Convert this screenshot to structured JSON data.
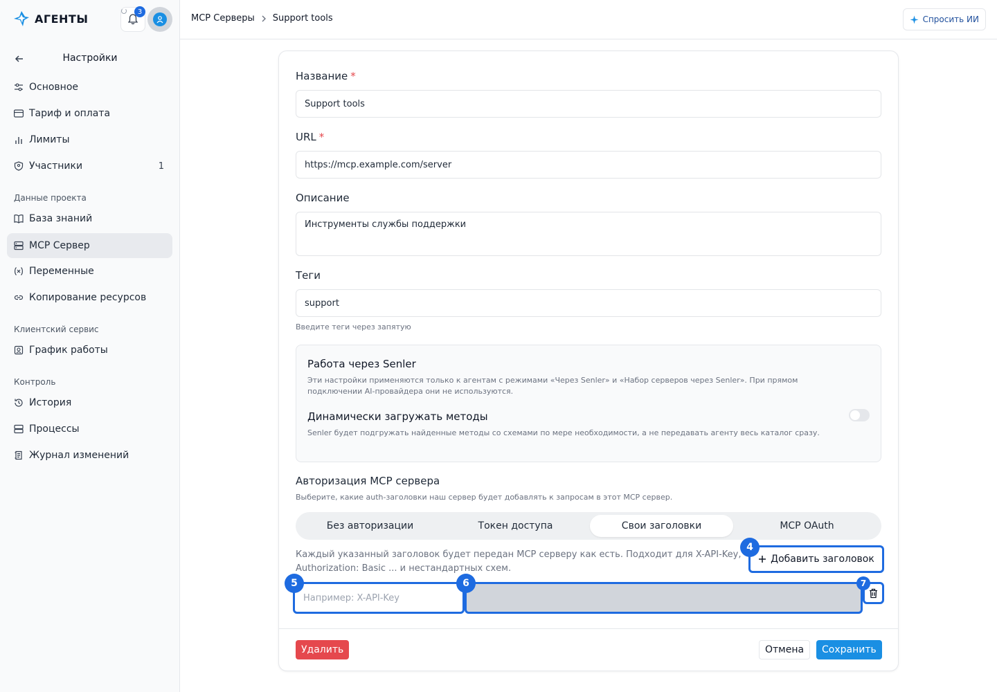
{
  "app": {
    "name": "АГЕНТЫ",
    "notification_count": "3"
  },
  "colors": {
    "accent": "#1e6be0",
    "save": "#1a8fe3",
    "danger": "#e5484d"
  },
  "sidebar": {
    "title": "Настройки",
    "items": [
      {
        "label": "Основное",
        "icon": "sliders-icon"
      },
      {
        "label": "Тариф и оплата",
        "icon": "card-icon"
      },
      {
        "label": "Лимиты",
        "icon": "bar-chart-icon"
      },
      {
        "label": "Участники",
        "icon": "shield-user-icon",
        "count": "1"
      }
    ],
    "project_label": "Данные проекта",
    "project_items": [
      {
        "label": "База знаний",
        "icon": "book-icon"
      },
      {
        "label": "MCP Сервер",
        "icon": "server-icon",
        "active": true
      },
      {
        "label": "Переменные",
        "icon": "variable-icon"
      },
      {
        "label": "Копирование ресурсов",
        "icon": "link-icon"
      }
    ],
    "client_label": "Клиентский сервис",
    "client_items": [
      {
        "label": "График работы",
        "icon": "schedule-icon"
      }
    ],
    "control_label": "Контроль",
    "control_items": [
      {
        "label": "История",
        "icon": "history-icon"
      },
      {
        "label": "Процессы",
        "icon": "server-icon"
      },
      {
        "label": "Журнал изменений",
        "icon": "log-icon"
      }
    ]
  },
  "header": {
    "breadcrumb": [
      "MCP Серверы",
      "Support tools"
    ],
    "ask_ai": "Спросить ИИ"
  },
  "form": {
    "name_label": "Название",
    "name_value": "Support tools",
    "url_label": "URL",
    "url_value": "https://mcp.example.com/server",
    "desc_label": "Описание",
    "desc_value": "Инструменты службы поддержки",
    "tags_label": "Теги",
    "tags_value": "support",
    "tags_hint": "Введите теги через запятую",
    "req_mark": "*"
  },
  "senler": {
    "title": "Работа через Senler",
    "desc": "Эти настройки применяются только к агентам с режимами «Через Senler» и «Набор серверов через Senler». При прямом подключении AI-провайдера они не используются.",
    "dyn_title": "Динамически загружать методы",
    "dyn_desc": "Senler будет подгружать найденные методы со схемами по мере необходимости, а не передавать агенту весь каталог сразу.",
    "dyn_enabled": false
  },
  "auth": {
    "title": "Авторизация MCP сервера",
    "subtitle": "Выберите, какие auth-заголовки наш сервер будет добавлять к запросам в этот MCP сервер.",
    "options": [
      "Без авторизации",
      "Токен доступа",
      "Свои заголовки",
      "MCP OAuth"
    ],
    "selected": "Свои заголовки",
    "headers_desc": "Каждый указанный заголовок будет передан MCP серверу как есть. Подходит для X-API-Key, Authorization: Basic ... и нестандартных схем.",
    "add_header": "Добавить заголовок",
    "header_name_placeholder": "Например: X-API-Key",
    "header_value": ""
  },
  "marks": {
    "m4": "4",
    "m5": "5",
    "m6": "6",
    "m7": "7"
  },
  "footer": {
    "delete": "Удалить",
    "cancel": "Отмена",
    "save": "Сохранить"
  }
}
